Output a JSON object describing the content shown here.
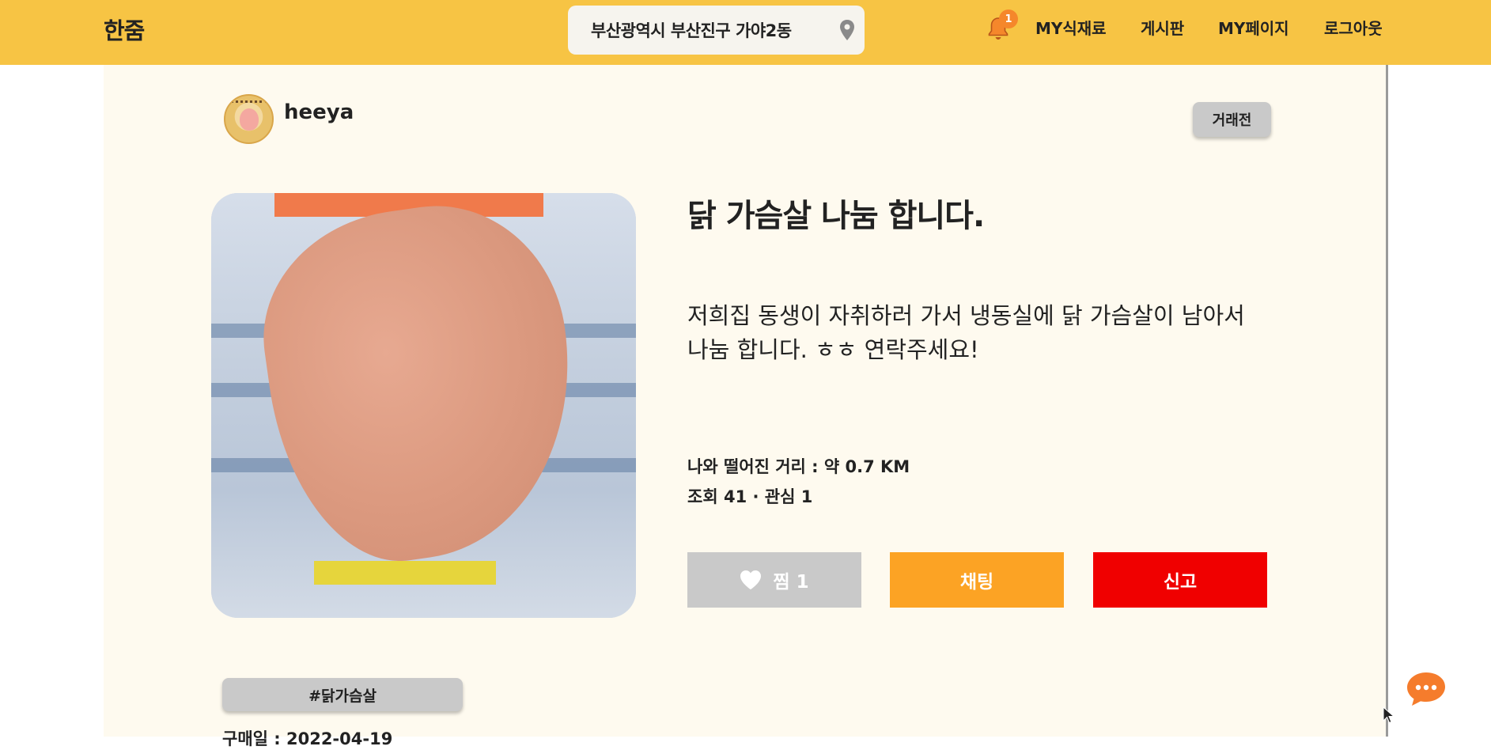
{
  "header": {
    "brand": "한줌",
    "location": "부산광역시 부산진구 가야2동",
    "notification_count": "1",
    "nav": [
      "MY식재료",
      "게시판",
      "MY페이지",
      "로그아웃"
    ]
  },
  "post": {
    "author": "heeya",
    "status": "거래전",
    "title": "닭 가슴살 나눔 합니다.",
    "body": "저희집 동생이 자취하러 가서 냉동실에 닭 가슴살이 남아서 나눔 합니다. ㅎㅎ 연락주세요!",
    "distance": "나와 떨어진 거리 : 약 0.7 KM",
    "stats": "조회 41 · 관심 1",
    "tag": "#닭가슴살",
    "purchase_date": "구매일 : 2022-04-19"
  },
  "actions": {
    "like_label": "찜 1",
    "chat_label": "채팅",
    "report_label": "신고"
  },
  "colors": {
    "header_bg": "#f7c444",
    "content_bg": "#fefaef",
    "chat_button": "#fca324",
    "report_button": "#f00000",
    "like_button": "#c9c9c9",
    "badge": "#f5872b"
  },
  "icons": {
    "location": "map-pin-icon",
    "notification": "bell-icon",
    "like": "heart-icon",
    "chat_fab": "chat-bubble-icon"
  }
}
